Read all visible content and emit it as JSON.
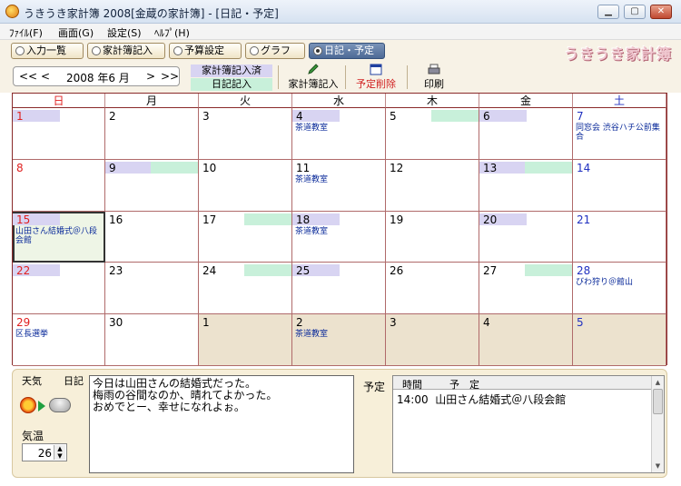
{
  "window": {
    "title": "うきうき家計簿 2008[金蔵の家計簿] - [日記・予定]",
    "min": "▁",
    "max": "▢",
    "close": "✕"
  },
  "menu": [
    {
      "label": "ﾌｧｲﾙ(F)"
    },
    {
      "label": "画面(G)"
    },
    {
      "label": "設定(S)"
    },
    {
      "label": "ﾍﾙﾌﾟ(H)"
    }
  ],
  "tabs": [
    {
      "label": "入力一覧"
    },
    {
      "label": "家計簿記入"
    },
    {
      "label": "予算設定"
    },
    {
      "label": "グラフ"
    },
    {
      "label": "日記・予定"
    }
  ],
  "logo": "うきうき家計簿",
  "nav": {
    "prev_year": "<<",
    "prev_month": "<",
    "month": "2008 年6 月",
    "next_month": ">",
    "next_year": ">>"
  },
  "legend": {
    "kakeibo": "家計簿記入済",
    "diary": "日記記入"
  },
  "toolbar": {
    "entry": "家計簿記入",
    "delete": "予定削除",
    "print": "印刷"
  },
  "weekdays": [
    "日",
    "月",
    "火",
    "水",
    "木",
    "金",
    "土"
  ],
  "colors": {
    "diary_band": "#d8d4f2",
    "kakeibo_band": "#c8f0da",
    "next_month_bg": "#ece2ce",
    "grid": "#8a2a2a",
    "event_text": "#0a2a9a"
  },
  "calendar": [
    [
      {
        "d": "1",
        "l": true
      },
      {
        "d": "2"
      },
      {
        "d": "3"
      },
      {
        "d": "4",
        "l": true,
        "e": "茶道教室"
      },
      {
        "d": "5",
        "r": true
      },
      {
        "d": "6",
        "l": true
      },
      {
        "d": "7",
        "e": "同窓会 渋谷ハチ公前集合"
      }
    ],
    [
      {
        "d": "8"
      },
      {
        "d": "9",
        "l": true,
        "r": true
      },
      {
        "d": "10"
      },
      {
        "d": "11",
        "e": "茶道教室"
      },
      {
        "d": "12"
      },
      {
        "d": "13",
        "l": true,
        "r": true
      },
      {
        "d": "14"
      }
    ],
    [
      {
        "d": "15",
        "l": true,
        "e": "山田さん結婚式＠八段会館",
        "sel": true
      },
      {
        "d": "16"
      },
      {
        "d": "17",
        "r": true
      },
      {
        "d": "18",
        "l": true,
        "e": "茶道教室"
      },
      {
        "d": "19"
      },
      {
        "d": "20",
        "l": true
      },
      {
        "d": "21"
      }
    ],
    [
      {
        "d": "22",
        "l": true
      },
      {
        "d": "23"
      },
      {
        "d": "24",
        "r": true
      },
      {
        "d": "25",
        "l": true
      },
      {
        "d": "26"
      },
      {
        "d": "27",
        "r": true
      },
      {
        "d": "28",
        "e": "びわ狩り＠館山"
      }
    ],
    [
      {
        "d": "29",
        "e": "区長選挙"
      },
      {
        "d": "30"
      },
      {
        "d": "1",
        "n": true
      },
      {
        "d": "2",
        "n": true,
        "e": "茶道教室"
      },
      {
        "d": "3",
        "n": true
      },
      {
        "d": "4",
        "n": true
      },
      {
        "d": "5",
        "n": true
      }
    ]
  ],
  "bottom": {
    "weather_label": "天気",
    "diary_label": "日記",
    "weather_icons": [
      "sun-icon",
      "cloud-icon"
    ],
    "temp_label": "気温",
    "temp_value": "26",
    "diary_lines": [
      "今日は山田さんの結婚式だった。",
      "梅雨の谷間なのか、晴れてよかった。",
      "おめでとー、幸せになれよぉ。"
    ],
    "schedule_label": "予定",
    "schedule_header": {
      "time": "時間",
      "plan": "予　定"
    },
    "schedule_rows": [
      {
        "time": "14:00",
        "plan": "山田さん結婚式＠八段会館"
      }
    ]
  }
}
